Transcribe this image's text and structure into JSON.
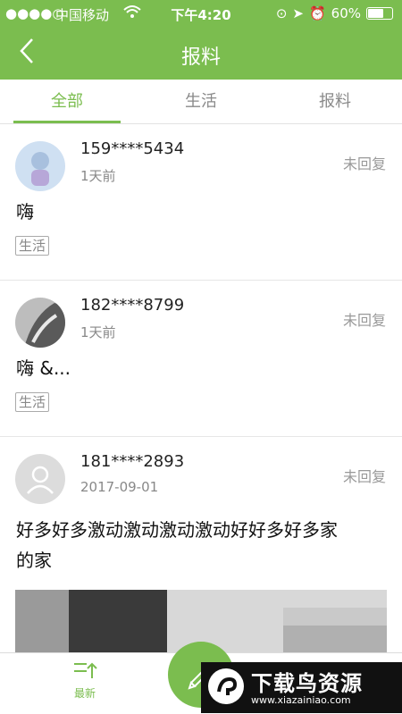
{
  "status_bar": {
    "signal": "●●●●○",
    "carrier": "中国移动",
    "time": "下午4:20",
    "battery": "60%"
  },
  "header": {
    "title": "报料"
  },
  "tabs": [
    {
      "label": "全部",
      "active": true
    },
    {
      "label": "生活",
      "active": false
    },
    {
      "label": "报料",
      "active": false
    }
  ],
  "posts": [
    {
      "user": "159****5434",
      "time": "1天前",
      "status": "未回复",
      "content": "嗨",
      "tag": "生活"
    },
    {
      "user": "182****8799",
      "time": "1天前",
      "status": "未回复",
      "content": "嗨 &...",
      "tag": "生活"
    },
    {
      "user": "181****2893",
      "time": "2017-09-01",
      "status": "未回复",
      "content_line1": "好多好多激动激动激动激动好好多好多家",
      "content_line2": "的家"
    }
  ],
  "bottom_nav": {
    "new_label": "最新"
  },
  "watermark": {
    "brand": "下载鸟资源",
    "url": "www.xiazainiao.com"
  },
  "colors": {
    "accent": "#7bbd4f"
  }
}
